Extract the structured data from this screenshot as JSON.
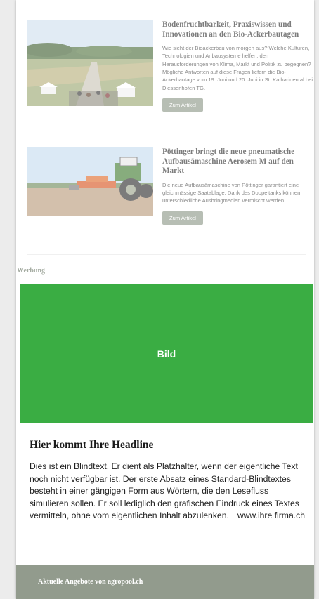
{
  "articles": [
    {
      "title": "Bodenfruchtbarkeit, Praxiswissen und Innovationen an den Bio-Ackerbautagen",
      "text": "Wie sieht der Bioackerbau von morgen aus? Welche Kulturen, Technologien und Anbausysteme helfen, den Herausforderungen von Klima, Markt und Politik zu begegnen? Mögliche Antworten auf diese Fragen liefern die Bio-Ackerbautage vom 19. Juni und 20. Juni in St. Katharinental bei Diessenhofen TG.",
      "button": "Zum Artikel",
      "image_icon": "field-event-photo"
    },
    {
      "title": "Pöttinger bringt die neue pneumatische Aufbausämaschine Aerosem M auf den Markt",
      "text": "Die neue Aufbausämaschine von Pöttinger garantiert eine gleichmässige Saatablage. Dank des Doppeltanks können unterschiedliche Ausbringmedien vermischt werden.",
      "button": "Zum Artikel",
      "image_icon": "tractor-photo"
    }
  ],
  "ad": {
    "label": "Werbung",
    "image_label": "Bild",
    "headline": "Hier kommt Ihre Headline",
    "text": "Dies ist ein Blindtext. Er dient als Platzhalter, wenn der eigentliche Text noch nicht verfügbar ist. Der erste Absatz eines Standard-Blindtextes besteht in einer gängigen Form aus Wörtern, die den Lesefluss simulieren sollen. Er soll lediglich den grafischen Eindruck eines Textes vermitteln, ohne vom eigentlichen Inhalt abzulenken.",
    "url": "www.ihre firma.ch"
  },
  "footer": {
    "title": "Aktuelle Angebote von agropool.ch"
  },
  "colors": {
    "button": "#8c9787",
    "ad_green": "#3aad43",
    "footer": "#929b8d"
  }
}
